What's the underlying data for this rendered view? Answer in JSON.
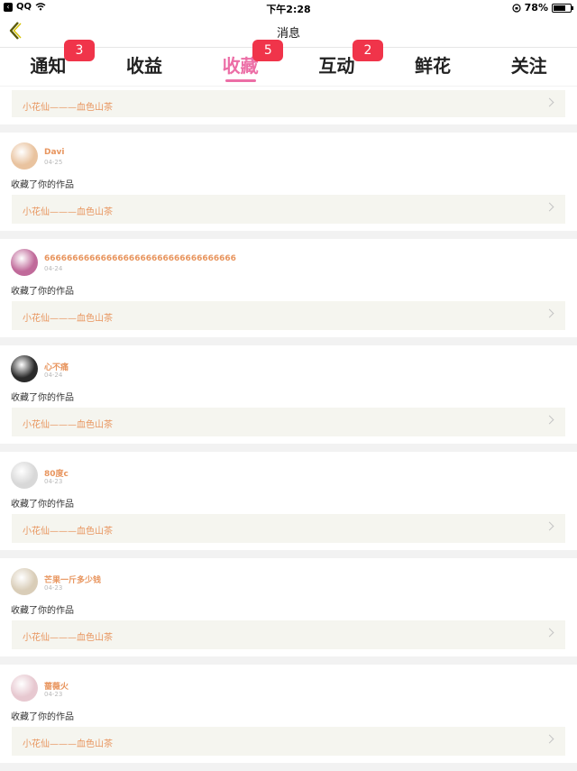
{
  "status_bar": {
    "back_icon": "back-app-icon",
    "carrier": "QQ",
    "wifi_icon": "wifi-icon",
    "time": "下午2:28",
    "battery_text": "78%",
    "battery_level": 0.78,
    "rotation_lock_icon": "rotation-lock-icon"
  },
  "header": {
    "title": "消息",
    "back_icon": "chevron-left-icon"
  },
  "tabs": [
    {
      "label": "通知",
      "badge": "3",
      "active": false
    },
    {
      "label": "收益",
      "badge": "",
      "active": false
    },
    {
      "label": "收藏",
      "badge": "5",
      "active": true
    },
    {
      "label": "互动",
      "badge": "2",
      "active": false
    },
    {
      "label": "鲜花",
      "badge": "",
      "active": false
    },
    {
      "label": "关注",
      "badge": "",
      "active": false
    }
  ],
  "colors": {
    "accent": "#ec6ea6",
    "badge": "#f0344a",
    "username": "#e8955e",
    "work_bg": "#f5f5ef"
  },
  "partial_item": {
    "work_title": "小花仙———血色山茶"
  },
  "items": [
    {
      "username": "Davi",
      "date": "04-25",
      "action": "收藏了你的作品",
      "work_title": "小花仙———血色山茶",
      "avatar_color": "#e9c39f"
    },
    {
      "username": "6666666666666666666666666666666666",
      "date": "04-24",
      "action": "收藏了你的作品",
      "work_title": "小花仙———血色山茶",
      "avatar_color": "#c06a9a"
    },
    {
      "username": "心不痛",
      "date": "04-24",
      "action": "收藏了你的作品",
      "work_title": "小花仙———血色山茶",
      "avatar_color": "#2a2a2a"
    },
    {
      "username": "80度c",
      "date": "04-23",
      "action": "收藏了你的作品",
      "work_title": "小花仙———血色山茶",
      "avatar_color": "#d8d8d8"
    },
    {
      "username": "芒果一斤多少钱",
      "date": "04-23",
      "action": "收藏了你的作品",
      "work_title": "小花仙———血色山茶",
      "avatar_color": "#d9cdb8"
    },
    {
      "username": "蔷薇火",
      "date": "04-23",
      "action": "收藏了你的作品",
      "work_title": "小花仙———血色山茶",
      "avatar_color": "#e7c8d0"
    }
  ]
}
